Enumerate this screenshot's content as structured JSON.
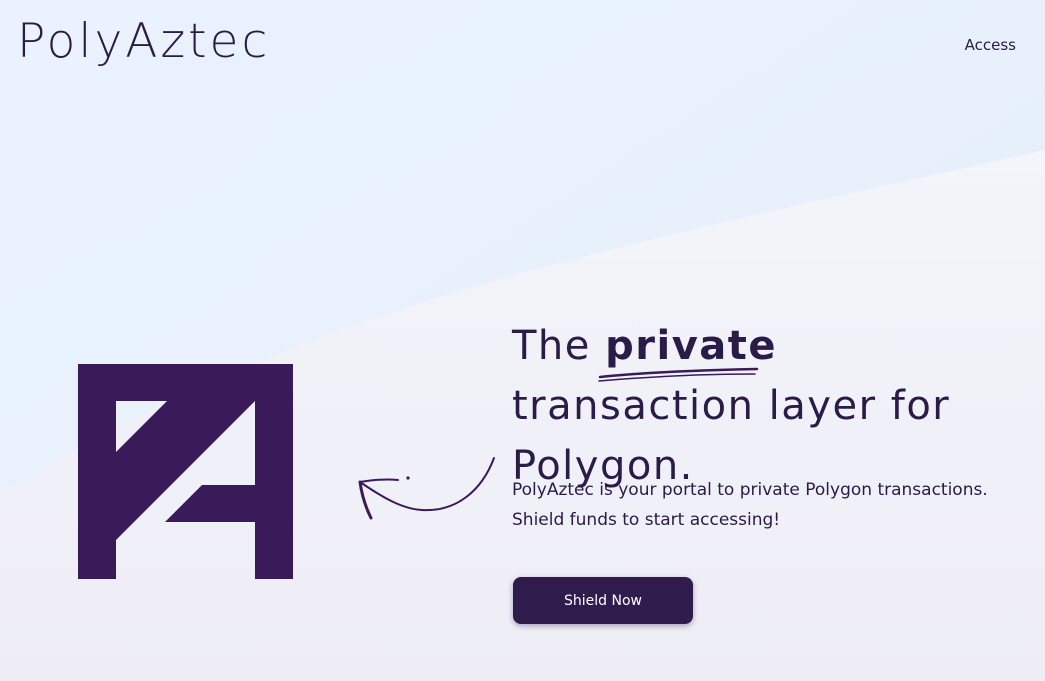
{
  "header": {
    "brand": "PolyAztec",
    "nav_access": "Access"
  },
  "hero": {
    "headline_before": "The",
    "headline_emphasis": "private",
    "headline_after": "transaction layer for Polygon.",
    "description_line1": "PolyAztec is your portal to private Polygon transactions.",
    "description_line2": "Shield funds to start accessing!",
    "cta_label": "Shield Now"
  },
  "icons": {
    "logo": "polyaztec-logo-icon",
    "arrow": "curved-arrow-icon"
  },
  "colors": {
    "brand_purple": "#3b1a5a",
    "text": "#2a1b47",
    "button_bg": "#2f1c4c",
    "bg_top": "#e8f1fb",
    "bg_bottom": "#efeff7"
  }
}
